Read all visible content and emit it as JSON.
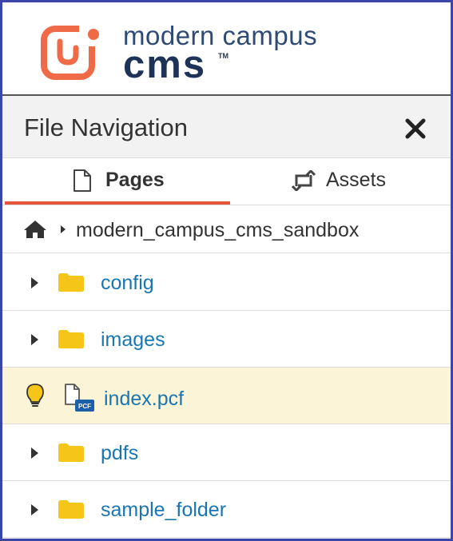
{
  "brand": {
    "line1": "modern campus",
    "line2": "cms",
    "tm": "TM"
  },
  "panel": {
    "title": "File Navigation"
  },
  "tabs": [
    {
      "label": "Pages",
      "icon": "page-icon",
      "active": true
    },
    {
      "label": "Assets",
      "icon": "swap-icon",
      "active": false
    }
  ],
  "breadcrumb": {
    "root_icon": "home-icon",
    "path": "modern_campus_cms_sandbox"
  },
  "items": [
    {
      "type": "folder",
      "label": "config"
    },
    {
      "type": "folder",
      "label": "images"
    },
    {
      "type": "file",
      "label": "index.pcf",
      "badge": "PCF",
      "highlighted": true
    },
    {
      "type": "folder",
      "label": "pdfs"
    },
    {
      "type": "folder",
      "label": "sample_folder"
    }
  ],
  "colors": {
    "accent": "#e8553d",
    "link": "#1a76b3",
    "folder": "#f5c518",
    "highlight_bg": "#fcf4d6",
    "frame_border": "#3a46a8"
  }
}
